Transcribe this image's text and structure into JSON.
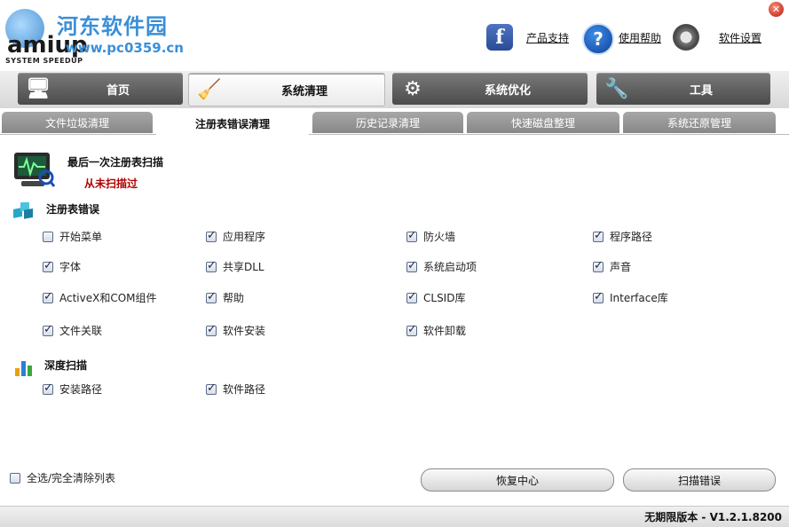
{
  "header": {
    "watermark_cn": "河东软件园",
    "watermark_url": "www.pc0359.cn",
    "logo_text": "amiup",
    "logo_tagline": "SYSTEM SPEEDUP",
    "links": {
      "support": "产品支持",
      "help": "使用帮助",
      "settings": "软件设置"
    },
    "icons": {
      "facebook": "facebook-icon",
      "help": "help-icon",
      "settings": "gear-icon",
      "close": "close-icon"
    }
  },
  "main_tabs": [
    {
      "label": "首页",
      "icon": "home-computer-icon",
      "active": false
    },
    {
      "label": "系统清理",
      "icon": "broom-icon",
      "active": true
    },
    {
      "label": "系统优化",
      "icon": "gear-icon",
      "active": false
    },
    {
      "label": "工具",
      "icon": "tools-icon",
      "active": false
    }
  ],
  "sub_tabs": [
    {
      "label": "文件垃圾清理",
      "active": false
    },
    {
      "label": "注册表错误清理",
      "active": true
    },
    {
      "label": "历史记录清理",
      "active": false
    },
    {
      "label": "快速磁盘整理",
      "active": false
    },
    {
      "label": "系统还原管理",
      "active": false
    }
  ],
  "scan_status": {
    "title": "最后一次注册表扫描",
    "status": "从未扫描过",
    "status_color": "#b00000"
  },
  "registry_errors": {
    "title": "注册表错误",
    "items": [
      {
        "label": "开始菜单",
        "checked": false
      },
      {
        "label": "应用程序",
        "checked": true
      },
      {
        "label": "防火墙",
        "checked": true
      },
      {
        "label": "程序路径",
        "checked": true
      },
      {
        "label": "字体",
        "checked": true
      },
      {
        "label": "共享DLL",
        "checked": true
      },
      {
        "label": "系统启动项",
        "checked": true
      },
      {
        "label": "声音",
        "checked": true
      },
      {
        "label": "ActiveX和COM组件",
        "checked": true
      },
      {
        "label": "帮助",
        "checked": true
      },
      {
        "label": "CLSID库",
        "checked": true
      },
      {
        "label": "Interface库",
        "checked": true
      },
      {
        "label": "文件关联",
        "checked": true
      },
      {
        "label": "软件安装",
        "checked": true
      },
      {
        "label": "软件卸载",
        "checked": true
      }
    ]
  },
  "deep_scan": {
    "title": "深度扫描",
    "items": [
      {
        "label": "安装路径",
        "checked": true
      },
      {
        "label": "软件路径",
        "checked": true
      }
    ]
  },
  "select_all": {
    "label": "全选/完全清除列表",
    "checked": false
  },
  "buttons": {
    "restore": "恢复中心",
    "scan": "扫描错误"
  },
  "footer": {
    "version": "无期限版本 - V1.2.1.8200"
  }
}
